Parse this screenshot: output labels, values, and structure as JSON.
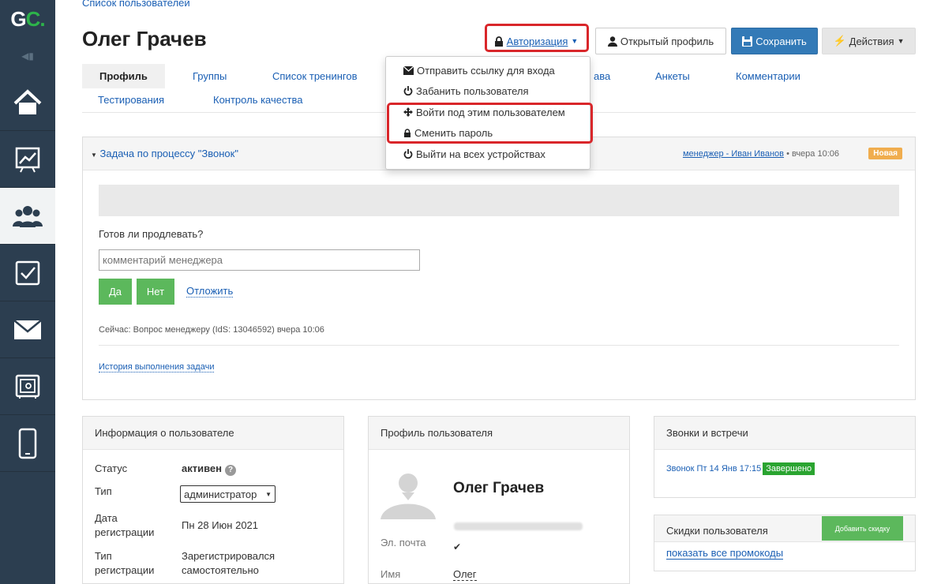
{
  "sidebar": {
    "logo_g": "G",
    "logo_c": "C.",
    "toggle": "◀▮",
    "items": [
      {
        "icon": "home-icon"
      },
      {
        "icon": "chart-icon"
      },
      {
        "icon": "users-icon",
        "active": true
      },
      {
        "icon": "checkbox-icon"
      },
      {
        "icon": "mail-icon"
      },
      {
        "icon": "safe-icon"
      },
      {
        "icon": "mobile-icon"
      }
    ]
  },
  "header": {
    "breadcrumb": "Список пользователей",
    "title": "Олег Грачев",
    "auth_button": "Авторизация",
    "open_profile_button": "Открытый профиль",
    "save_button": "Сохранить",
    "actions_button": "Действия"
  },
  "tabs": {
    "profile": "Профиль",
    "groups": "Группы",
    "trainings": "Список тренингов",
    "rights": "ава",
    "surveys": "Анкеты",
    "comments": "Комментарии",
    "testing": "Тестирования",
    "quality": "Контроль качества"
  },
  "dropdown": {
    "send_link": "Отправить ссылку для входа",
    "ban": "Забанить пользователя",
    "login_as": "Войти под этим пользователем",
    "change_password": "Сменить пароль",
    "logout_all": "Выйти на всех устройствах"
  },
  "task": {
    "title": "Задача по процессу \"Звонок\"",
    "manager_link": "менеджер - Иван Иванов",
    "time": " • вчера 10:06",
    "badge": "Новая",
    "question": "Готов ли продлевать?",
    "comment_placeholder": "комментарий менеджера",
    "yes": "Да",
    "no": "Нет",
    "postpone": "Отложить",
    "now": "Сейчас: Вопрос менеджеру (IdS: 13046592) вчера 10:06",
    "history": "История выполнения задачи"
  },
  "user_info": {
    "heading": "Информация о пользователе",
    "status_label": "Статус",
    "status_value": "активен",
    "help": "?",
    "type_label": "Тип",
    "type_value": "администратор",
    "reg_date_label": "Дата регистрации",
    "reg_date_value": "Пн 28 Июн 2021",
    "reg_type_label": "Тип регистрации",
    "reg_type_value": "Зарегистрировался самостоятельно"
  },
  "user_profile": {
    "heading": "Профиль пользователя",
    "name": "Олег Грачев",
    "email_label": "Эл. почта",
    "verified": "✔",
    "first_name_label": "Имя",
    "first_name_value": "Олег"
  },
  "calls": {
    "heading": "Звонки и встречи",
    "item": "Звонок Пт 14 Янв 17:15",
    "status": "Завершено"
  },
  "discounts": {
    "heading": "Скидки пользователя",
    "add_button": "Добавить скидку",
    "show_promos": "показать все промокоды"
  },
  "colors": {
    "sidebar": "#2c3e50",
    "accent_green": "#2db34a",
    "highlight_red": "#d9262a",
    "save_blue": "#337ab7",
    "badge_orange": "#f0ad4e"
  }
}
